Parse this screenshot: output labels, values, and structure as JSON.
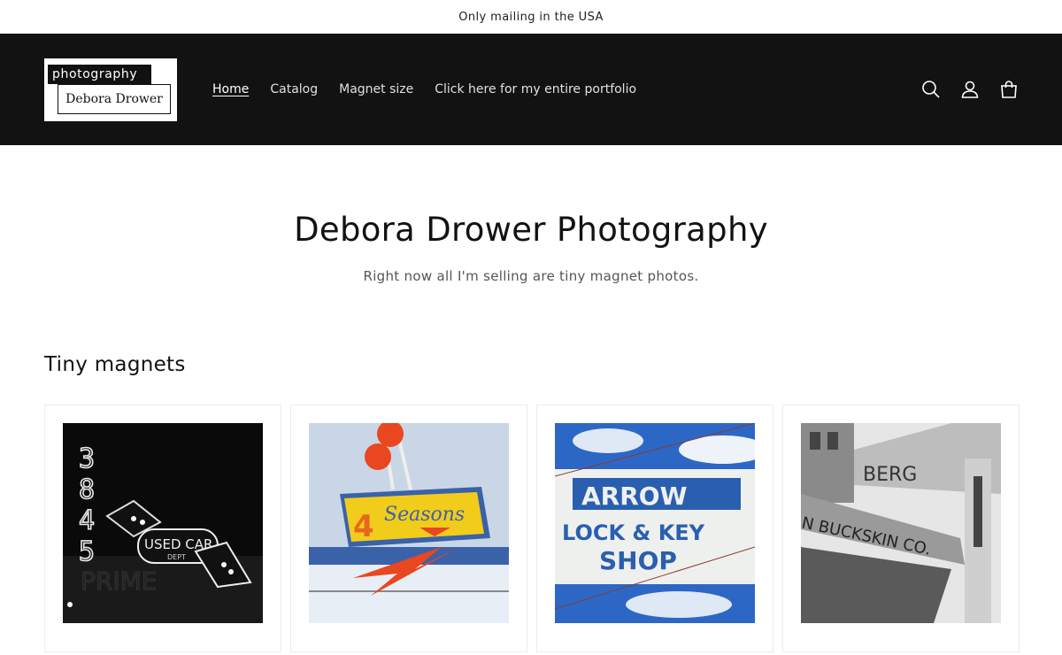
{
  "announcement": "Only mailing in the USA",
  "logo": {
    "top_text": "photography",
    "name_text": "Debora Drower"
  },
  "nav": [
    {
      "label": "Home",
      "active": true
    },
    {
      "label": "Catalog"
    },
    {
      "label": "Magnet size"
    },
    {
      "label": "Click here for my entire portfolio"
    }
  ],
  "header_icons": [
    "search-icon",
    "account-icon",
    "cart-icon"
  ],
  "hero": {
    "title": "Debora Drower Photography",
    "subtitle": "Right now all I'm selling are tiny magnet photos."
  },
  "collection": {
    "title": "Tiny magnets",
    "products": [
      {
        "sign_text": "USED CAR DEPT",
        "sign_numbers": "3845",
        "sign_sub": "PRIME"
      },
      {
        "sign_text": "4 Seasons"
      },
      {
        "sign_text": "ARROW",
        "sign_sub": "LOCK & KEY",
        "sign_sub2": "SHOP"
      },
      {
        "sign_text": "BUCKSKIN CO."
      }
    ]
  },
  "colors": {
    "header_bg": "#121212",
    "accent": "#ffffff"
  }
}
